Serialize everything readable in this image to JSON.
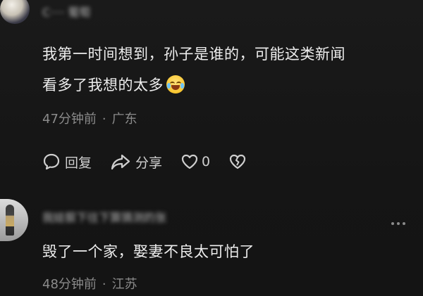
{
  "comments": [
    {
      "username": "C···· 葡萄",
      "text_line1": "我第一时间想到，孙子是谁的，可能这类新闻",
      "text_line2": "看多了我想的太多",
      "emoji": "crying-laughing-emoji",
      "time": "47分钟前",
      "location": "广东",
      "actions": {
        "reply_label": "回复",
        "share_label": "分享",
        "like_count": "0"
      }
    },
    {
      "username": "我娃狠下往下算猜测的张",
      "text": "毁了一个家，娶妻不良太可怕了",
      "time": "48分钟前",
      "location": "江苏"
    }
  ],
  "separator": "·",
  "icons": {
    "reply": "comment-bubble-icon",
    "share": "share-arrow-icon",
    "like": "heart-icon",
    "dislike": "broken-heart-icon",
    "more": "more-dots-icon"
  },
  "colors": {
    "background": "#161616",
    "text": "#ededed",
    "meta": "#8b8b8b"
  }
}
